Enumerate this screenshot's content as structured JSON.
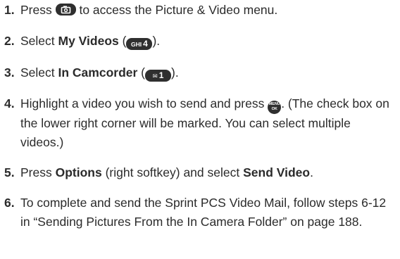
{
  "steps": [
    {
      "num": "1.",
      "parts": [
        "Press ",
        " to access the Picture & Video menu."
      ]
    },
    {
      "num": "2.",
      "parts": [
        "Select ",
        "My Videos",
        " (",
        ")."
      ],
      "key_small": "GHI",
      "key_big": "4"
    },
    {
      "num": "3.",
      "parts": [
        "Select ",
        "In Camcorder",
        " (",
        ")."
      ],
      "key_small": "✉",
      "key_big": "1"
    },
    {
      "num": "4.",
      "parts": [
        "Highlight a video you wish to send and press ",
        ". (The check box on the lower right corner will be marked. You can select multiple videos.)"
      ],
      "key_top": "MENU",
      "key_bottom": "OK"
    },
    {
      "num": "5.",
      "parts": [
        "Press ",
        "Options",
        " (right softkey) and select ",
        "Send Video",
        "."
      ]
    },
    {
      "num": "6.",
      "parts": [
        "To complete and send the Sprint PCS Video Mail, follow steps 6-12 in “Sending Pictures From the In Camera Folder” on page 188."
      ]
    }
  ]
}
